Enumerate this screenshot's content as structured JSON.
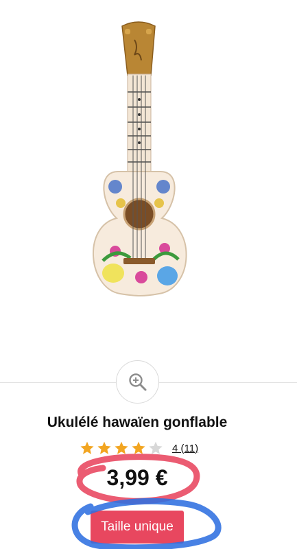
{
  "product": {
    "image_alt": "Ukulele gonflable",
    "title": "Ukulélé hawaïen gonflable",
    "rating_value": 4,
    "rating_max": 5,
    "rating_text": "4 (11)",
    "price": "3,99 €",
    "size_label": "Taille unique"
  },
  "icons": {
    "zoom": "zoom-in-icon",
    "star": "star-icon"
  },
  "colors": {
    "star_filled": "#f2a521",
    "star_empty": "#d8d8d8",
    "size_button": "#e8475f",
    "annotation_red": "#e8465e",
    "annotation_blue": "#2f6fe0"
  }
}
